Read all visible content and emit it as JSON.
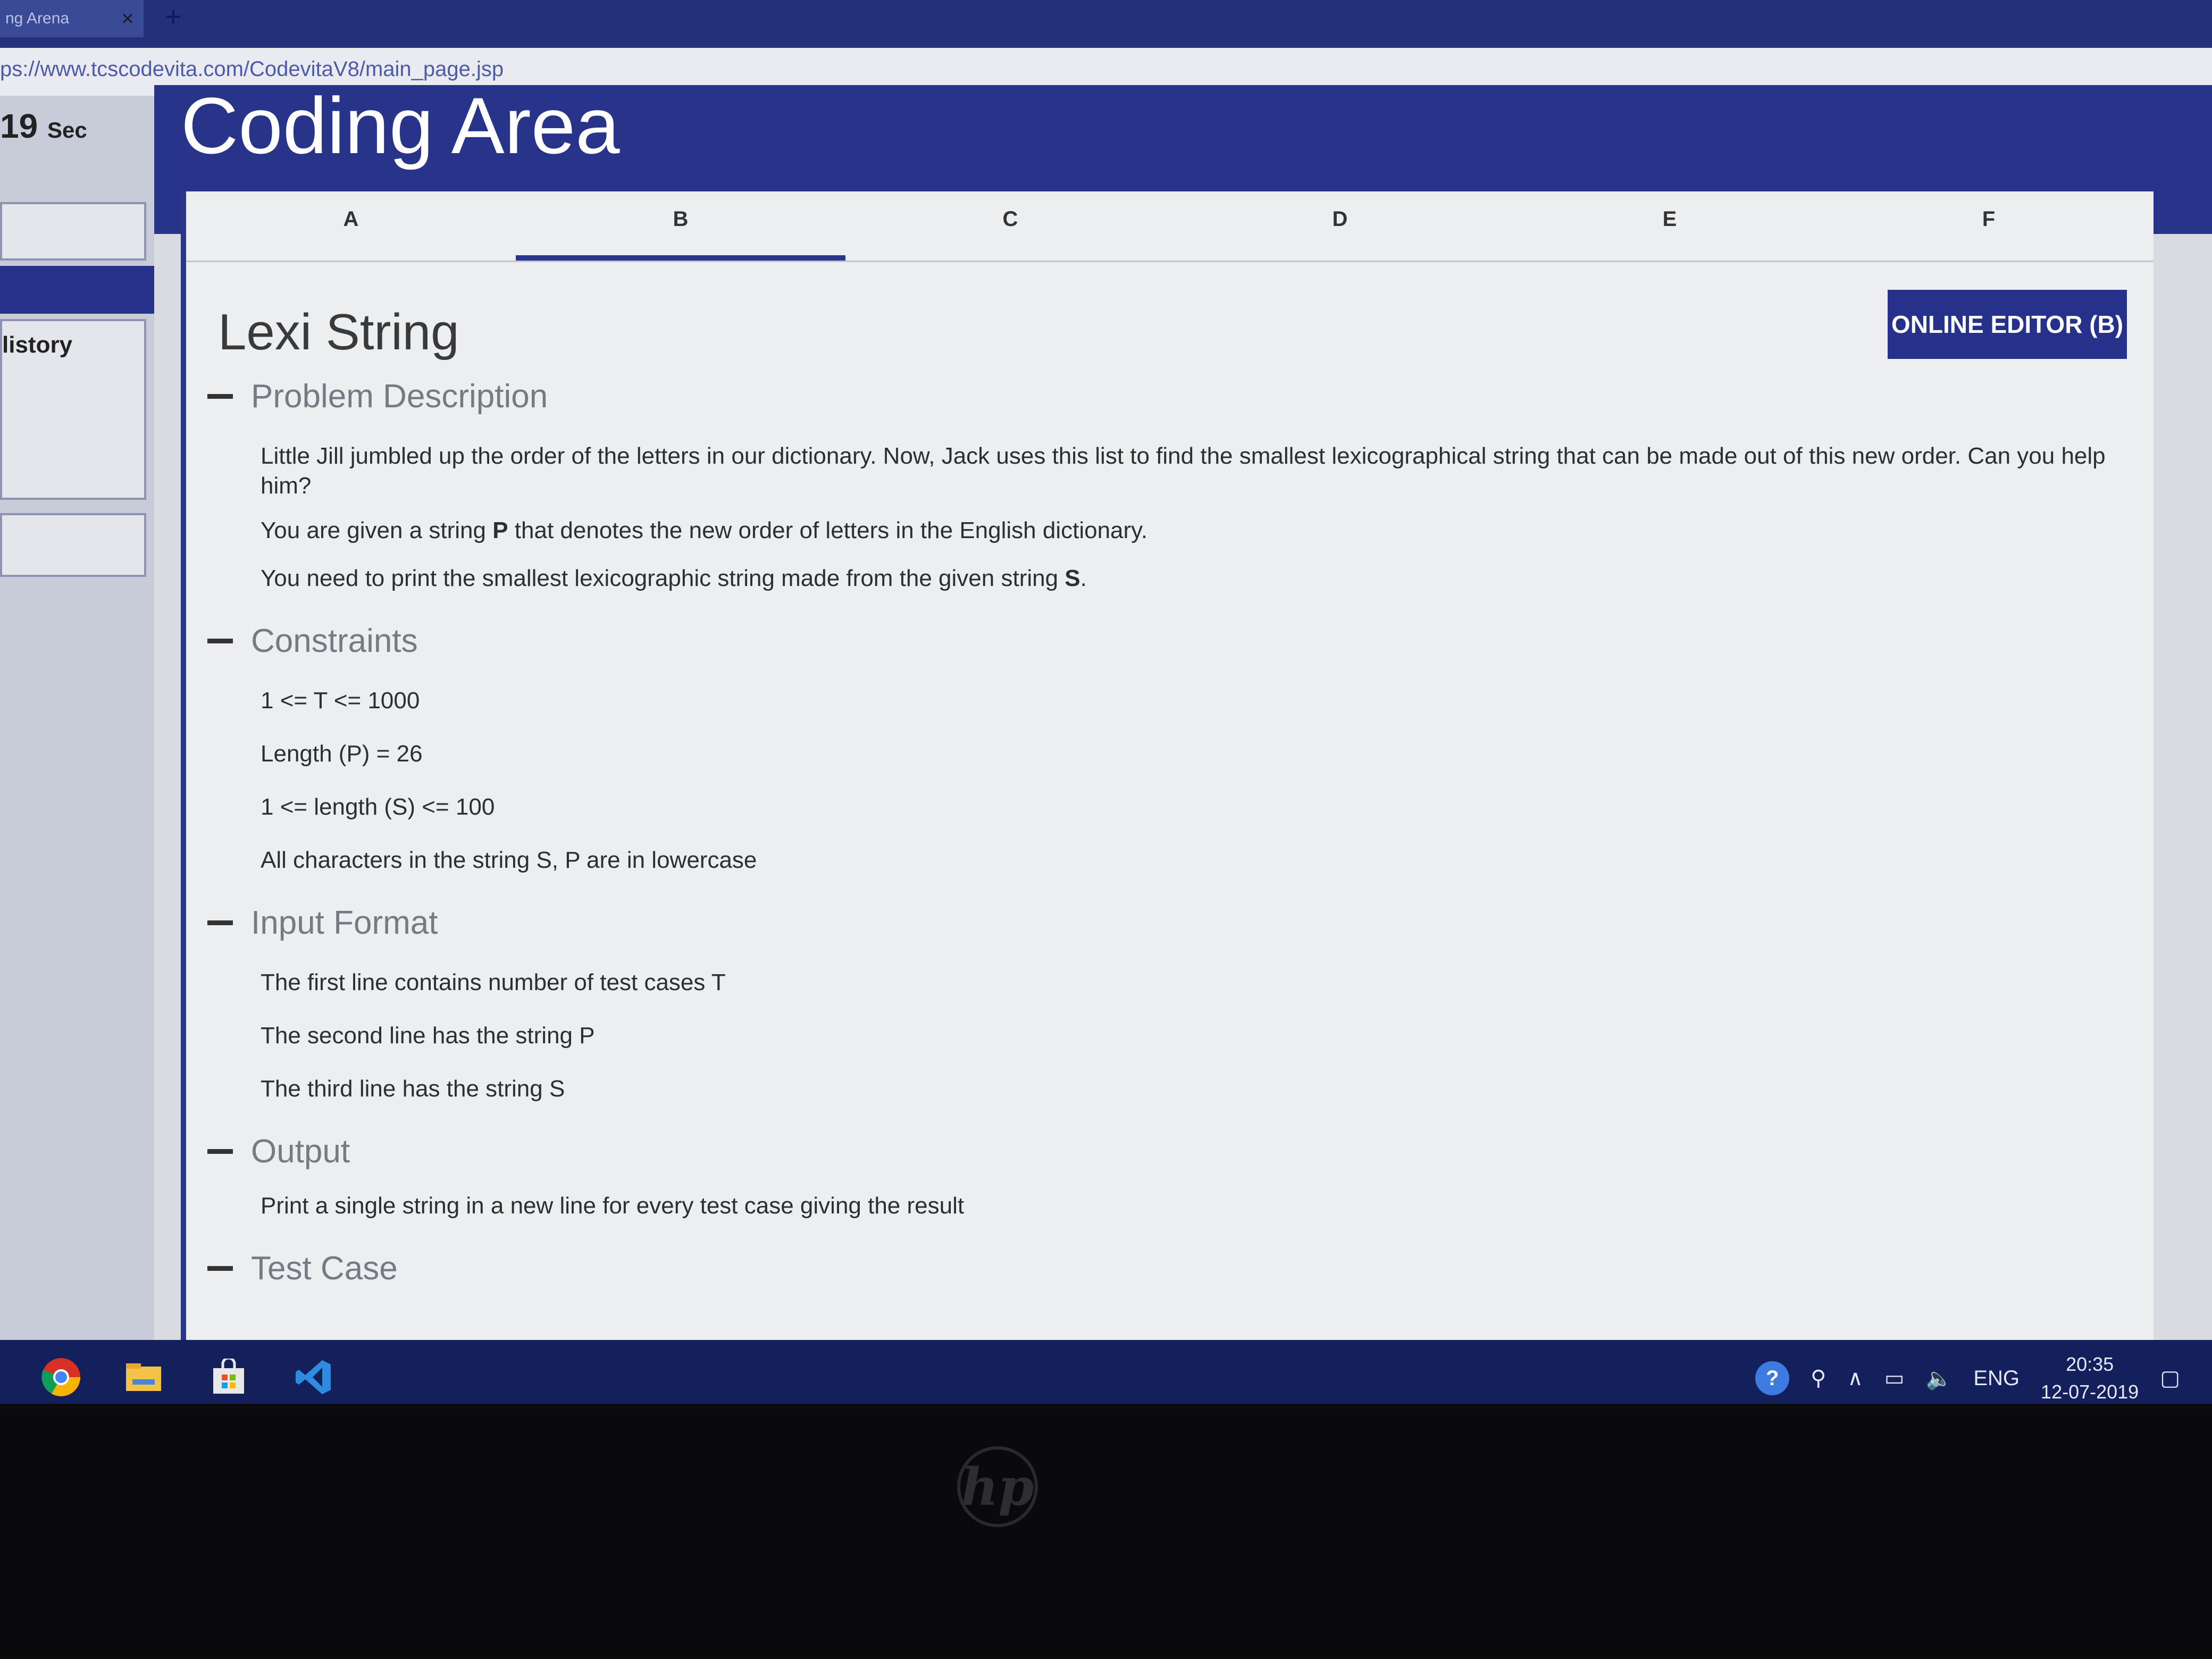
{
  "browser": {
    "tab_title": "ng Arena",
    "tab_close": "×",
    "new_tab": "+",
    "url": "ps://www.tcscodevita.com/CodevitaV8/main_page.jsp"
  },
  "sidebar": {
    "timer_value": "19",
    "timer_unit": "Sec",
    "history_label": "listory"
  },
  "header": {
    "title": "Coding Area"
  },
  "problem_tabs": [
    {
      "label": "A"
    },
    {
      "label": "B"
    },
    {
      "label": "C"
    },
    {
      "label": "D"
    },
    {
      "label": "E"
    },
    {
      "label": "F"
    }
  ],
  "active_tab": "B",
  "editor_button": "ONLINE EDITOR (B)",
  "problem": {
    "title": "Lexi String",
    "sections": {
      "description": {
        "heading": "Problem Description",
        "line1": "Little Jill jumbled up the order of the letters in our dictionary. Now, Jack uses this list to find the smallest lexicographical string that can be made out of this new order. Can you help him?",
        "line2_pre": "You are given a string ",
        "line2_bold": "P",
        "line2_post": " that denotes the new order of letters in the English dictionary.",
        "line3_pre": "You need to print the smallest lexicographic string made from the given string ",
        "line3_bold": "S",
        "line3_post": "."
      },
      "constraints": {
        "heading": "Constraints",
        "items": [
          "1 <= T <= 1000",
          "Length (P) = 26",
          "1 <= length (S) <= 100",
          "All characters in the string S, P are in lowercase"
        ]
      },
      "input_format": {
        "heading": "Input Format",
        "items": [
          "The first line contains number of test cases T",
          "The second line has the string P",
          "The third line has the string S"
        ]
      },
      "output": {
        "heading": "Output",
        "text": "Print a single string in a new line for every test case giving the result"
      },
      "test_case": {
        "heading": "Test Case"
      }
    }
  },
  "taskbar": {
    "icons": [
      "chrome-icon",
      "file-explorer-icon",
      "store-icon",
      "vscode-icon"
    ],
    "tray": {
      "language": "ENG",
      "time": "20:35",
      "date": "12-07-2019"
    }
  },
  "bezel": {
    "logo_text": "hp"
  },
  "colors": {
    "header_blue": "#28348a",
    "button_blue": "#25318a",
    "card_bg": "#eceef0"
  }
}
